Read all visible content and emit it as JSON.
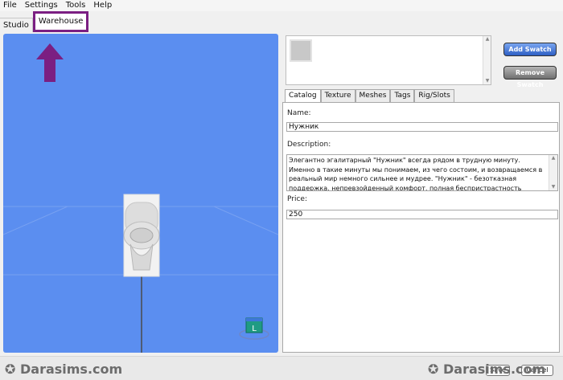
{
  "menu": [
    "File",
    "Settings",
    "Tools",
    "Help"
  ],
  "main_tabs": [
    {
      "label": "Studio"
    },
    {
      "label": "Warehouse"
    }
  ],
  "swatch_buttons": {
    "add": "Add Swatch",
    "remove": "Remove Swatch"
  },
  "sub_tabs": [
    "Catalog",
    "Texture",
    "Meshes",
    "Tags",
    "Rig/Slots"
  ],
  "catalog": {
    "name_label": "Name:",
    "name_value": "Нужник",
    "description_label": "Description:",
    "description_value": "Элегантно эгалитарный \"Нужник\" всегда рядом в трудную минуту. Именно в такие минуты мы понимаем, из чего состоим, и возвращаемся в реальный мир немного сильнее и мудрее. \"Нужник\" - безотказная поддержка, непревзойденный комфорт, полная беспристрастность",
    "price_label": "Price:",
    "price_value": "250"
  },
  "viewport": {
    "background_color": "#5b8ef0",
    "badge_letter": "L"
  },
  "footer": {
    "watermark_left": "Darasims.com",
    "watermark_right": "Darasims.com",
    "save_label": "Save",
    "cancel_label": "Cancel"
  },
  "colors": {
    "highlight": "#7b1f82",
    "add_button": "#2e5fc4",
    "remove_button": "#707070"
  }
}
